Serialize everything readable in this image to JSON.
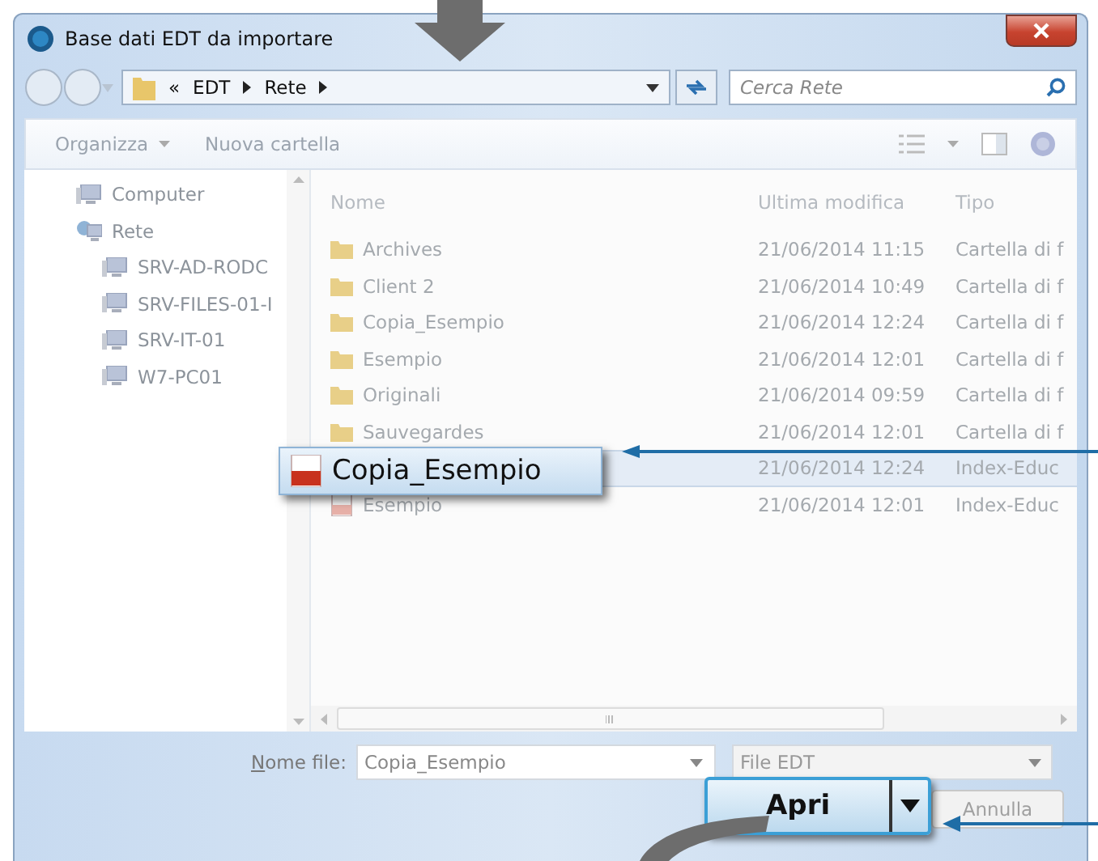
{
  "window": {
    "title": "Base dati EDT da importare"
  },
  "address": {
    "crumbs": [
      "«",
      "EDT",
      "Rete"
    ]
  },
  "search": {
    "placeholder": "Cerca Rete"
  },
  "toolbar": {
    "items": [
      "Organizza",
      "Nuova cartella"
    ]
  },
  "nav": {
    "items": [
      {
        "label": "Computer",
        "kind": "computer"
      },
      {
        "label": "Rete",
        "kind": "network",
        "children": [
          {
            "label": "SRV-AD-RODC",
            "kind": "computer"
          },
          {
            "label": "SRV-FILES-01-I",
            "kind": "computer"
          },
          {
            "label": "SRV-IT-01",
            "kind": "computer"
          },
          {
            "label": "W7-PC01",
            "kind": "computer"
          }
        ]
      }
    ]
  },
  "files": {
    "columns": [
      "Nome",
      "Ultima modifica",
      "Tipo"
    ],
    "rows": [
      {
        "name": "Archives",
        "modified": "21/06/2014 11:15",
        "type": "Cartella di f",
        "kind": "folder",
        "selected": false
      },
      {
        "name": "Client 2",
        "modified": "21/06/2014 10:49",
        "type": "Cartella di f",
        "kind": "folder",
        "selected": false
      },
      {
        "name": "Copia_Esempio",
        "modified": "21/06/2014 12:24",
        "type": "Cartella di f",
        "kind": "folder",
        "selected": false
      },
      {
        "name": "Esempio",
        "modified": "21/06/2014 12:01",
        "type": "Cartella di f",
        "kind": "folder",
        "selected": false
      },
      {
        "name": "Originali",
        "modified": "21/06/2014 09:59",
        "type": "Cartella di f",
        "kind": "folder",
        "selected": false
      },
      {
        "name": "Sauvegardes",
        "modified": "21/06/2014 12:01",
        "type": "Cartella di f",
        "kind": "folder",
        "selected": false
      },
      {
        "modified": "21/06/2014 12:24",
        "type": "Index-Educ",
        "selected": true
      },
      {
        "name": "Esempio",
        "modified": "21/06/2014 12:01",
        "type": "Index-Educ",
        "kind": "edt",
        "selected": false
      }
    ]
  },
  "filename": {
    "label": "Nome file:",
    "value": "Copia_Esempio"
  },
  "filetype": {
    "value": "File EDT"
  },
  "buttons": [
    {
      "label": "Apri"
    },
    {
      "label": "Annulla"
    }
  ],
  "callouts": {
    "file": {
      "label": "Copia_Esempio"
    }
  }
}
